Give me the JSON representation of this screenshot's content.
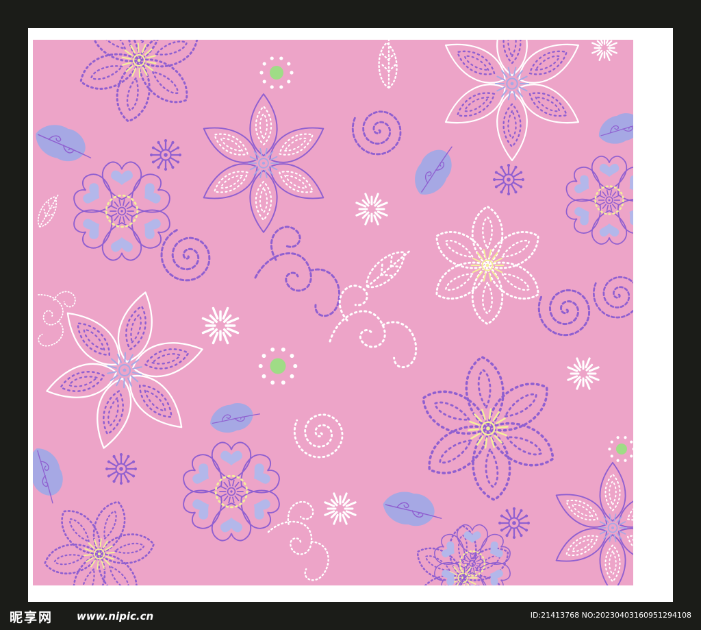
{
  "background_colors": {
    "outer": "#1b1c18",
    "frame": "#ffffff",
    "pattern": "#eda4c8"
  },
  "palette": {
    "purple": "#8f5fd0",
    "white": "#ffffff",
    "lavender_leaf": "#a6a8e4",
    "yellow_center": "#f4ef9a",
    "green_dot": "#9fdc86",
    "light_heart": "#b3b7ea"
  },
  "pattern": {
    "motifs": [
      "six-petal-dotted-flower",
      "heart-petal-flower",
      "pointed-petal-flower",
      "dotted-swirl",
      "starburst",
      "leaf",
      "green-dot-ring"
    ]
  },
  "watermark": {
    "site_logo": "昵享网",
    "site_url": "www.nipic.cn",
    "image_id": "ID:21413768 NO:20230403160951294108"
  }
}
